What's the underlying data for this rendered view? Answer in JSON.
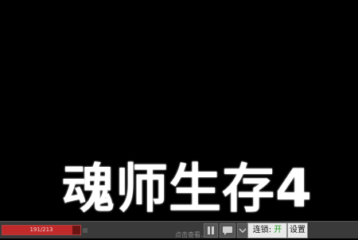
{
  "overlay": {
    "title": "魂师生存4"
  },
  "hud": {
    "hp_text": "191/213",
    "hp_fraction": 0.9,
    "hint": "点击查看...",
    "pause_icon": "pause-icon",
    "chat_icon": "chat-icon",
    "more_icon": "chevron-down-icon",
    "lock_label": "连锁:",
    "lock_state": "开",
    "settings_label": "设置"
  },
  "colors": {
    "lock_on": "#1c9a1c",
    "hp": "#c02a2a"
  }
}
